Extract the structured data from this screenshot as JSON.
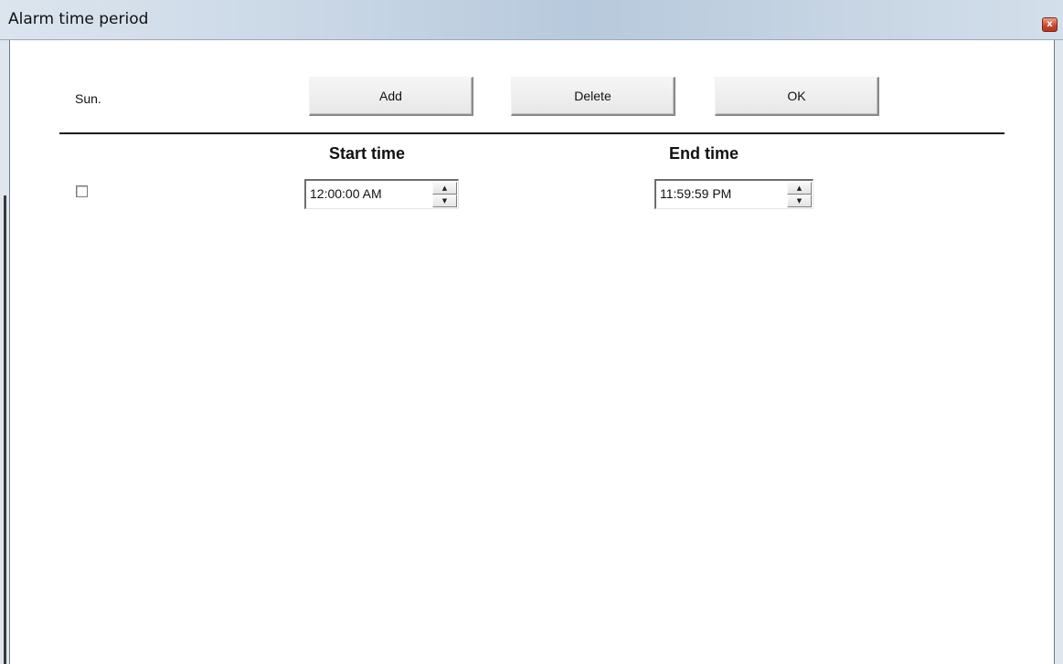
{
  "window": {
    "title": "Alarm time period",
    "close_glyph": "x"
  },
  "toolbar": {
    "day_label": "Sun.",
    "add_label": "Add",
    "delete_label": "Delete",
    "ok_label": "OK"
  },
  "columns": {
    "start_header": "Start time",
    "end_header": "End time"
  },
  "rows": [
    {
      "checked": false,
      "start_time": "12:00:00 AM",
      "end_time": "11:59:59 PM"
    }
  ],
  "spinner": {
    "up_glyph": "▲",
    "down_glyph": "▼"
  },
  "icons": [
    "close-icon",
    "spinner-up-icon",
    "spinner-down-icon",
    "checkbox-icon"
  ]
}
